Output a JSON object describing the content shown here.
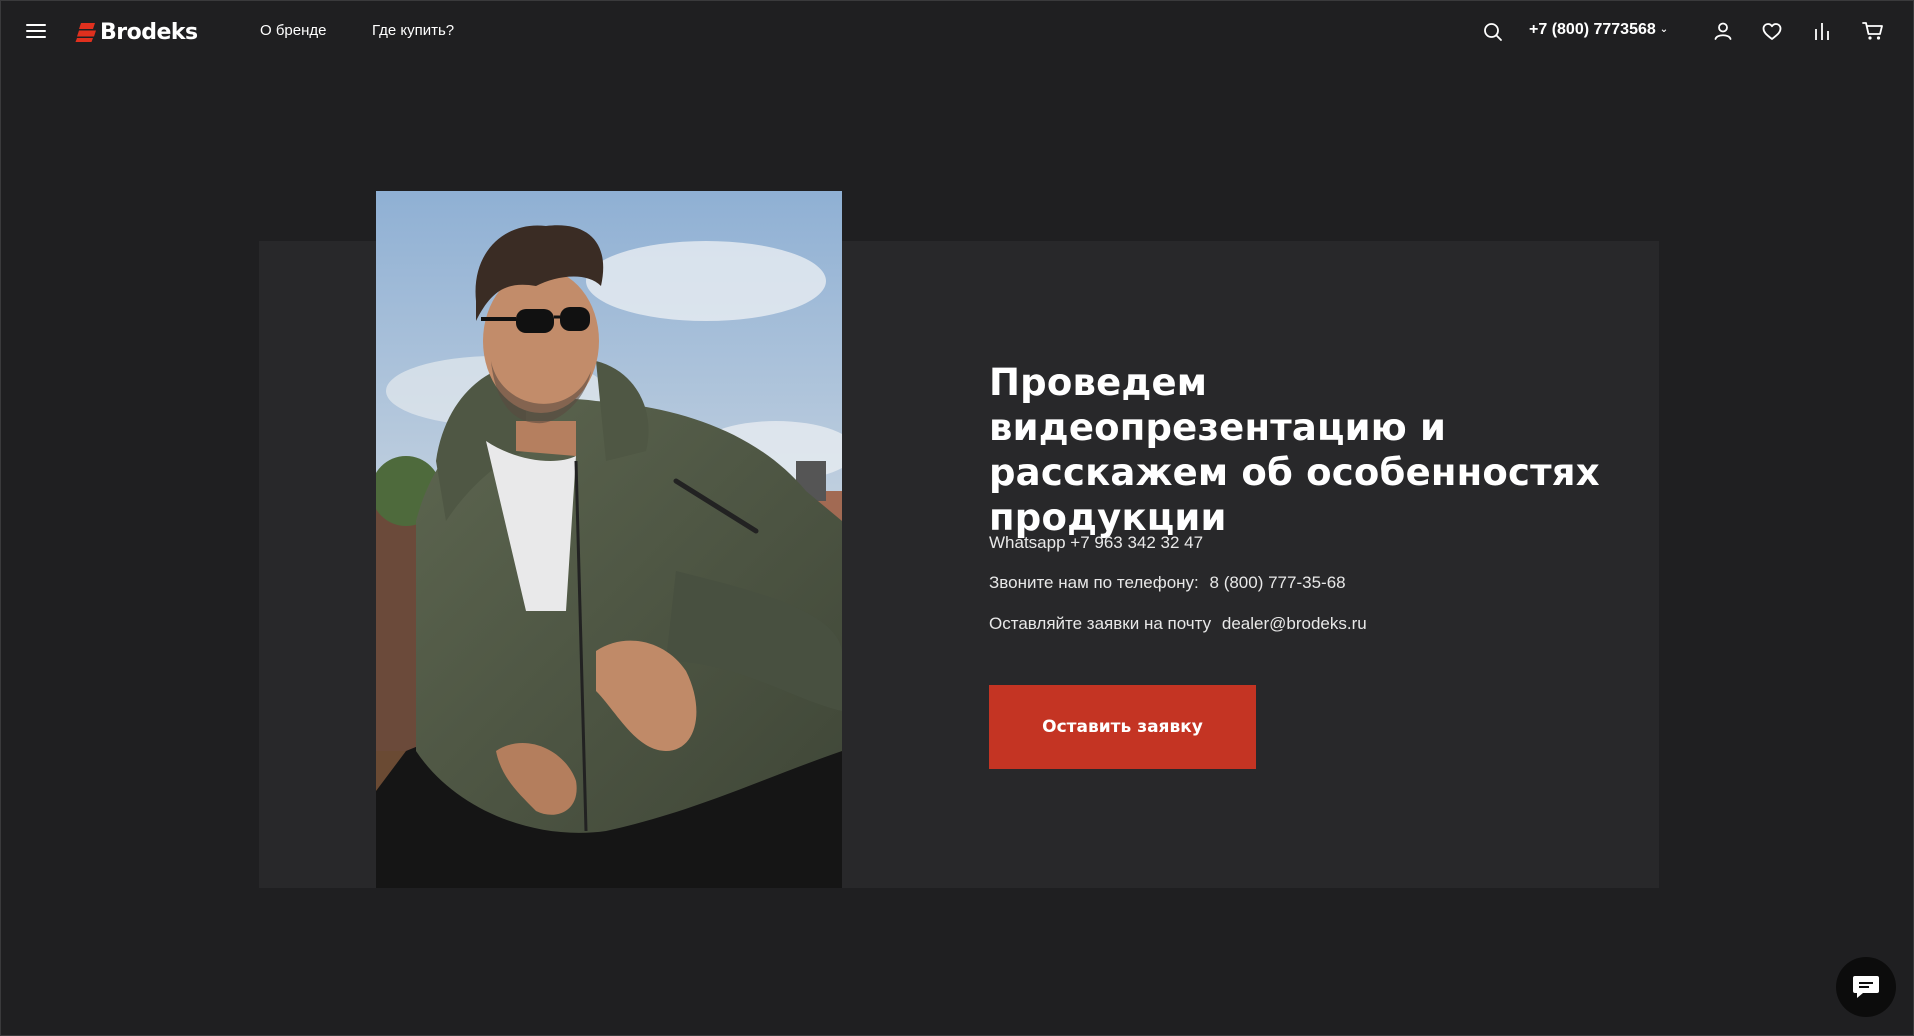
{
  "header": {
    "logo_text": "Brodeks",
    "nav": [
      "О бренде",
      "Где купить?"
    ],
    "phone": "+7 (800) 7773568",
    "icons": [
      "menu-icon",
      "search-icon",
      "chevron-down-icon",
      "user-icon",
      "heart-icon",
      "compare-icon",
      "cart-icon"
    ]
  },
  "promo": {
    "headline": "Проведем видеопрезентацию и расскажем об особенностях продукции",
    "whatsapp": "Whatsapp +7 963 342 32 47",
    "phone_label": "Звоните нам по телефону:",
    "phone_value": "8 (800) 777-35-68",
    "email_label": "Оставляйте заявки на почту",
    "email_value": "dealer@brodeks.ru",
    "cta_label": "Оставить заявку"
  },
  "colors": {
    "background": "#1f1f21",
    "panel": "#28282a",
    "accent": "#c43423",
    "brand_red": "#e0301e"
  },
  "chat": {
    "icon": "chat-icon"
  }
}
